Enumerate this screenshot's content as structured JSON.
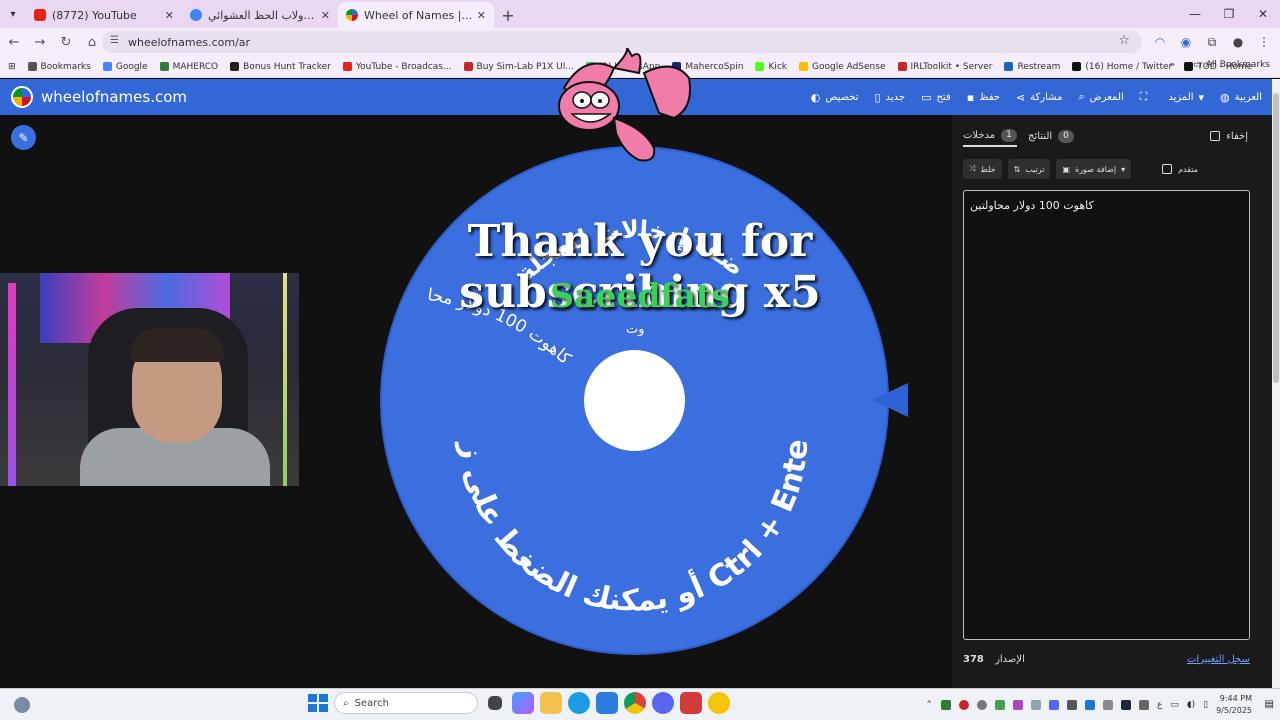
{
  "browser": {
    "tabs": [
      {
        "title": "(8772) YouTube",
        "color": "#e62117",
        "active": false
      },
      {
        "title": "دولاب الحظ العشوائي - Search",
        "color": "#4285f4",
        "active": false
      },
      {
        "title": "Wheel of Names | دولاب الاسم العشوائي",
        "color": "#3369e8",
        "active": true
      }
    ],
    "url": "wheelofnames.com/ar",
    "bookmarks": [
      {
        "label": "Bookmarks",
        "color": "#555"
      },
      {
        "label": "Google",
        "color": "#4285f4"
      },
      {
        "label": "MAHERCO",
        "color": "#2e7d32"
      },
      {
        "label": "Bonus Hunt Tracker",
        "color": "#222"
      },
      {
        "label": "YouTube - Broadcas...",
        "color": "#e62117"
      },
      {
        "label": "Buy Sim-Lab P1X Ul...",
        "color": "#c62828"
      },
      {
        "label": "(2) WhatsApp",
        "color": "#25d366"
      },
      {
        "label": "MahercoSpin",
        "color": "#1a237e"
      },
      {
        "label": "Kick",
        "color": "#53fc18"
      },
      {
        "label": "Google AdSense",
        "color": "#fbbc04"
      },
      {
        "label": "IRLToolkit • Server",
        "color": "#c62828"
      },
      {
        "label": "Restream",
        "color": "#1565c0"
      },
      {
        "label": "(16) Home / Twitter",
        "color": "#111"
      },
      {
        "label": "TOD - Home",
        "color": "#111"
      }
    ],
    "all_bookmarks": "All Bookmarks"
  },
  "site": {
    "name": "wheelofnames.com",
    "menu": [
      {
        "label": "العربية",
        "icon": "globe-icon"
      },
      {
        "label": "المزيد",
        "icon": "chevron-down-icon"
      },
      {
        "label": "",
        "icon": "fullscreen-icon"
      },
      {
        "label": "المعرض",
        "icon": "search-icon"
      },
      {
        "label": "مشاركة",
        "icon": "share-icon"
      },
      {
        "label": "حفظ",
        "icon": "save-icon"
      },
      {
        "label": "فتح",
        "icon": "folder-icon"
      },
      {
        "label": "جديد",
        "icon": "file-icon"
      },
      {
        "label": "تخصيص",
        "icon": "palette-icon"
      }
    ]
  },
  "wheel": {
    "color": "#3b6fe0",
    "overlay_title": "Thank you for subscribing x5",
    "overlay_name": "Saeedfats",
    "partial_text": "وت",
    "curved_bottom": "أو يمكنك الضغط على زر Ctrl + Enter",
    "curved_top": "أضف إدخالات للعجلة",
    "curved_left": "كاهوت 100 دولار محا"
  },
  "panel": {
    "tab_entries": "مدخلات",
    "entries_count": "1",
    "tab_results": "النتائج",
    "results_count": "0",
    "hide_label": "إخفاء",
    "shuffle": "خلط",
    "sort": "ترتيب",
    "add_image": "إضافة صورة",
    "advanced": "متقدم",
    "entries_text": "كاهوت 100 دولار محاولتين",
    "version_label": "الإصدار",
    "version": "378",
    "changelog": "سجل التغييرات"
  },
  "taskbar": {
    "search": "Search",
    "lang": "ع",
    "time": "9:44 PM",
    "date": "9/5/2025"
  }
}
